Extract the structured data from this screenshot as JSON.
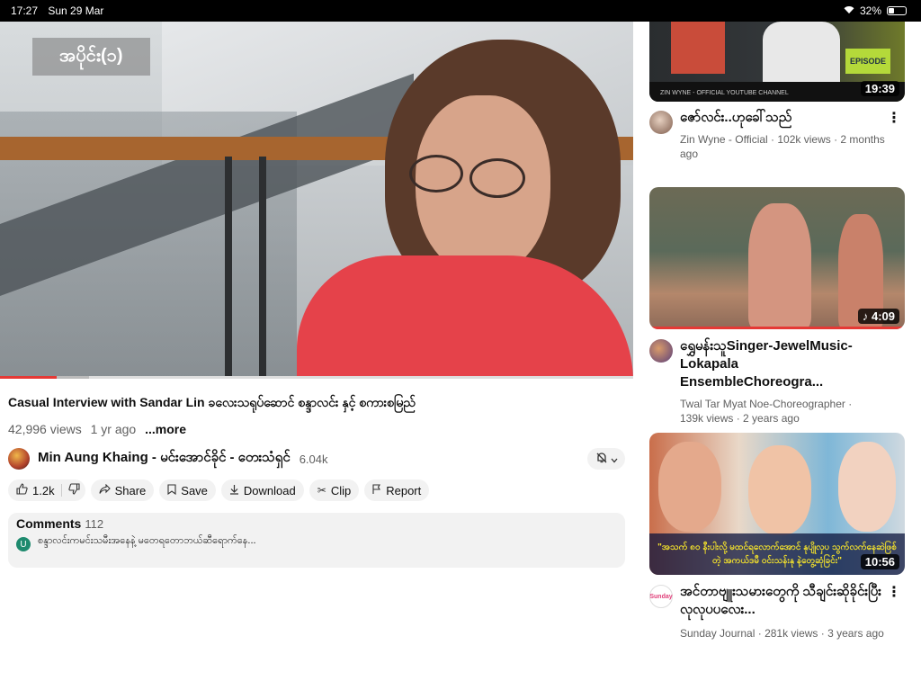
{
  "status": {
    "time": "17:27",
    "date": "Sun 29 Mar",
    "battery": "32%"
  },
  "player": {
    "overlay_title": "အပိုင်း(၁)",
    "progress": 0.09
  },
  "video": {
    "title": "Casual Interview with Sandar Lin  ခလေးသရုပ်ဆောင် စန္ဒာလင်း နှင့် စကားစမြည်",
    "views": "42,996 views",
    "age": "1 yr ago",
    "more": "...more"
  },
  "channel": {
    "name": "Min Aung Khaing  - မင်းအောင်ခိုင်  - တေးသံရှင်",
    "subs": "6.04k"
  },
  "actions": {
    "likes": "1.2k",
    "share": "Share",
    "save": "Save",
    "download": "Download",
    "clip": "Clip",
    "report": "Report"
  },
  "comments": {
    "label": "Comments",
    "count": "112",
    "top": {
      "avatar_letter": "U",
      "text": "စန္ဒာလင်းကမင်းသမီးအနေနဲ့ မတေရတောဘယ်ဆီရောက်နေ..."
    }
  },
  "recommendations": [
    {
      "title": "ဇော်လင်း..ဟုခေါ်သည်",
      "channel": "Zin Wyne - Official",
      "views": "102k views",
      "age": "2 months ago",
      "duration": "19:39",
      "thumb_brand": "ZIN WYNE - OFFICIAL YOUTUBE CHANNEL",
      "thumb_tag": "EPISODE",
      "accent": "#b4d93a"
    },
    {
      "title": "ရွှေမန်းသူSinger-JewelMusic-Lokapala EnsembleChoreogra...",
      "channel": "Twal Tar Myat Noe-Choreographer",
      "views": "139k views",
      "age": "2 years ago",
      "duration": "♪ 4:09",
      "accent": "#e53935"
    },
    {
      "title": "အင်တာဗျူးသမားတွေကို သီချင်းဆိုခိုင်းပြီးလုလုပပလေး...",
      "channel": "Sunday Journal",
      "views": "281k views",
      "age": "3 years ago",
      "duration": "10:56",
      "thumb_caption": "\"အသက် ၈၀ နီးပါးလို့ မထင်ရလောက်အောင် နုပျိုလှပ သွက်လက်နေဆဲဖြစ်တဲ့ အကယ်ဒမီ ဝင်းသန်းနု နဲ့တွေ့ဆုံခြင်း\"",
      "avatar_text": "Sunday",
      "accent": "#f3e12c"
    }
  ]
}
